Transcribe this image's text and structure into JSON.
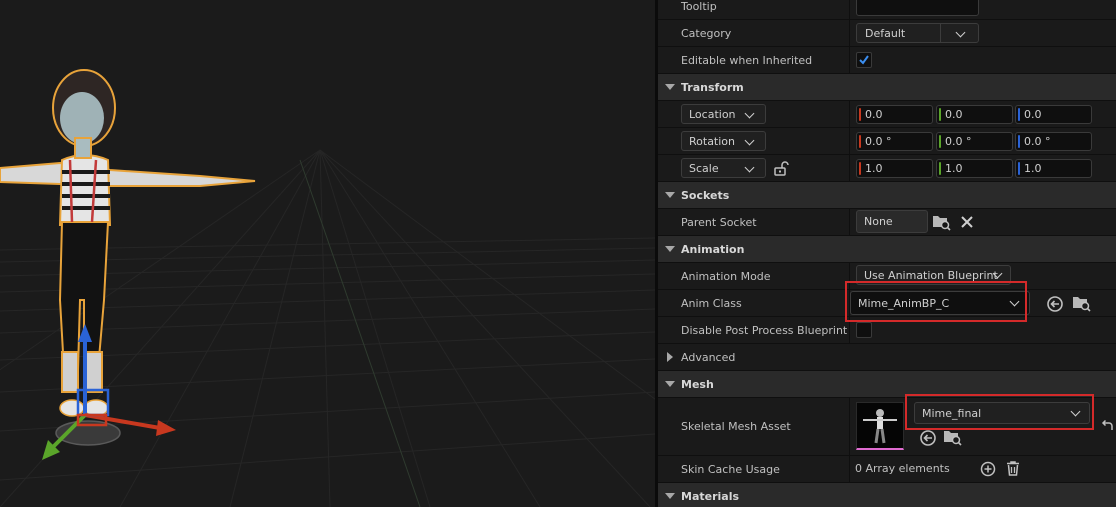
{
  "panel": {
    "rows": {
      "tooltip": {
        "label": "Tooltip"
      },
      "category": {
        "label": "Category",
        "value": "Default"
      },
      "editable": {
        "label": "Editable when Inherited",
        "checked": true
      },
      "transform": {
        "label": "Transform"
      },
      "location": {
        "label": "Location",
        "x": "0.0",
        "y": "0.0",
        "z": "0.0"
      },
      "rotation": {
        "label": "Rotation",
        "x": "0.0 °",
        "y": "0.0 °",
        "z": "0.0 °"
      },
      "scale": {
        "label": "Scale",
        "x": "1.0",
        "y": "1.0",
        "z": "1.0"
      },
      "sockets": {
        "label": "Sockets"
      },
      "parent_socket": {
        "label": "Parent Socket",
        "value": "None"
      },
      "animation": {
        "label": "Animation"
      },
      "anim_mode": {
        "label": "Animation Mode",
        "value": "Use Animation Blueprint"
      },
      "anim_class": {
        "label": "Anim Class",
        "value": "Mime_AnimBP_C"
      },
      "disable_ppb": {
        "label": "Disable Post Process Blueprint",
        "checked": false
      },
      "advanced": {
        "label": "Advanced"
      },
      "mesh": {
        "label": "Mesh"
      },
      "skel_mesh": {
        "label": "Skeletal Mesh Asset",
        "value": "Mime_final"
      },
      "skin_cache": {
        "label": "Skin Cache Usage",
        "value": "0 Array elements"
      },
      "materials": {
        "label": "Materials"
      }
    }
  },
  "colors": {
    "x_axis": "#c8381f",
    "y_axis": "#5aa52a",
    "z_axis": "#2a63d6",
    "highlight": "#d42a2a",
    "accent": "#3b8ef0"
  }
}
